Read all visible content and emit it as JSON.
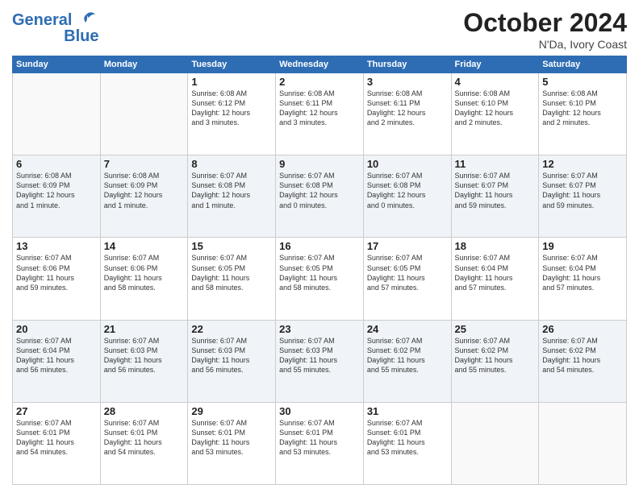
{
  "header": {
    "logo_line1": "General",
    "logo_line2": "Blue",
    "month": "October 2024",
    "location": "N'Da, Ivory Coast"
  },
  "weekdays": [
    "Sunday",
    "Monday",
    "Tuesday",
    "Wednesday",
    "Thursday",
    "Friday",
    "Saturday"
  ],
  "weeks": [
    [
      {
        "day": "",
        "info": ""
      },
      {
        "day": "",
        "info": ""
      },
      {
        "day": "1",
        "info": "Sunrise: 6:08 AM\nSunset: 6:12 PM\nDaylight: 12 hours\nand 3 minutes."
      },
      {
        "day": "2",
        "info": "Sunrise: 6:08 AM\nSunset: 6:11 PM\nDaylight: 12 hours\nand 3 minutes."
      },
      {
        "day": "3",
        "info": "Sunrise: 6:08 AM\nSunset: 6:11 PM\nDaylight: 12 hours\nand 2 minutes."
      },
      {
        "day": "4",
        "info": "Sunrise: 6:08 AM\nSunset: 6:10 PM\nDaylight: 12 hours\nand 2 minutes."
      },
      {
        "day": "5",
        "info": "Sunrise: 6:08 AM\nSunset: 6:10 PM\nDaylight: 12 hours\nand 2 minutes."
      }
    ],
    [
      {
        "day": "6",
        "info": "Sunrise: 6:08 AM\nSunset: 6:09 PM\nDaylight: 12 hours\nand 1 minute."
      },
      {
        "day": "7",
        "info": "Sunrise: 6:08 AM\nSunset: 6:09 PM\nDaylight: 12 hours\nand 1 minute."
      },
      {
        "day": "8",
        "info": "Sunrise: 6:07 AM\nSunset: 6:08 PM\nDaylight: 12 hours\nand 1 minute."
      },
      {
        "day": "9",
        "info": "Sunrise: 6:07 AM\nSunset: 6:08 PM\nDaylight: 12 hours\nand 0 minutes."
      },
      {
        "day": "10",
        "info": "Sunrise: 6:07 AM\nSunset: 6:08 PM\nDaylight: 12 hours\nand 0 minutes."
      },
      {
        "day": "11",
        "info": "Sunrise: 6:07 AM\nSunset: 6:07 PM\nDaylight: 11 hours\nand 59 minutes."
      },
      {
        "day": "12",
        "info": "Sunrise: 6:07 AM\nSunset: 6:07 PM\nDaylight: 11 hours\nand 59 minutes."
      }
    ],
    [
      {
        "day": "13",
        "info": "Sunrise: 6:07 AM\nSunset: 6:06 PM\nDaylight: 11 hours\nand 59 minutes."
      },
      {
        "day": "14",
        "info": "Sunrise: 6:07 AM\nSunset: 6:06 PM\nDaylight: 11 hours\nand 58 minutes."
      },
      {
        "day": "15",
        "info": "Sunrise: 6:07 AM\nSunset: 6:05 PM\nDaylight: 11 hours\nand 58 minutes."
      },
      {
        "day": "16",
        "info": "Sunrise: 6:07 AM\nSunset: 6:05 PM\nDaylight: 11 hours\nand 58 minutes."
      },
      {
        "day": "17",
        "info": "Sunrise: 6:07 AM\nSunset: 6:05 PM\nDaylight: 11 hours\nand 57 minutes."
      },
      {
        "day": "18",
        "info": "Sunrise: 6:07 AM\nSunset: 6:04 PM\nDaylight: 11 hours\nand 57 minutes."
      },
      {
        "day": "19",
        "info": "Sunrise: 6:07 AM\nSunset: 6:04 PM\nDaylight: 11 hours\nand 57 minutes."
      }
    ],
    [
      {
        "day": "20",
        "info": "Sunrise: 6:07 AM\nSunset: 6:04 PM\nDaylight: 11 hours\nand 56 minutes."
      },
      {
        "day": "21",
        "info": "Sunrise: 6:07 AM\nSunset: 6:03 PM\nDaylight: 11 hours\nand 56 minutes."
      },
      {
        "day": "22",
        "info": "Sunrise: 6:07 AM\nSunset: 6:03 PM\nDaylight: 11 hours\nand 56 minutes."
      },
      {
        "day": "23",
        "info": "Sunrise: 6:07 AM\nSunset: 6:03 PM\nDaylight: 11 hours\nand 55 minutes."
      },
      {
        "day": "24",
        "info": "Sunrise: 6:07 AM\nSunset: 6:02 PM\nDaylight: 11 hours\nand 55 minutes."
      },
      {
        "day": "25",
        "info": "Sunrise: 6:07 AM\nSunset: 6:02 PM\nDaylight: 11 hours\nand 55 minutes."
      },
      {
        "day": "26",
        "info": "Sunrise: 6:07 AM\nSunset: 6:02 PM\nDaylight: 11 hours\nand 54 minutes."
      }
    ],
    [
      {
        "day": "27",
        "info": "Sunrise: 6:07 AM\nSunset: 6:01 PM\nDaylight: 11 hours\nand 54 minutes."
      },
      {
        "day": "28",
        "info": "Sunrise: 6:07 AM\nSunset: 6:01 PM\nDaylight: 11 hours\nand 54 minutes."
      },
      {
        "day": "29",
        "info": "Sunrise: 6:07 AM\nSunset: 6:01 PM\nDaylight: 11 hours\nand 53 minutes."
      },
      {
        "day": "30",
        "info": "Sunrise: 6:07 AM\nSunset: 6:01 PM\nDaylight: 11 hours\nand 53 minutes."
      },
      {
        "day": "31",
        "info": "Sunrise: 6:07 AM\nSunset: 6:01 PM\nDaylight: 11 hours\nand 53 minutes."
      },
      {
        "day": "",
        "info": ""
      },
      {
        "day": "",
        "info": ""
      }
    ]
  ]
}
